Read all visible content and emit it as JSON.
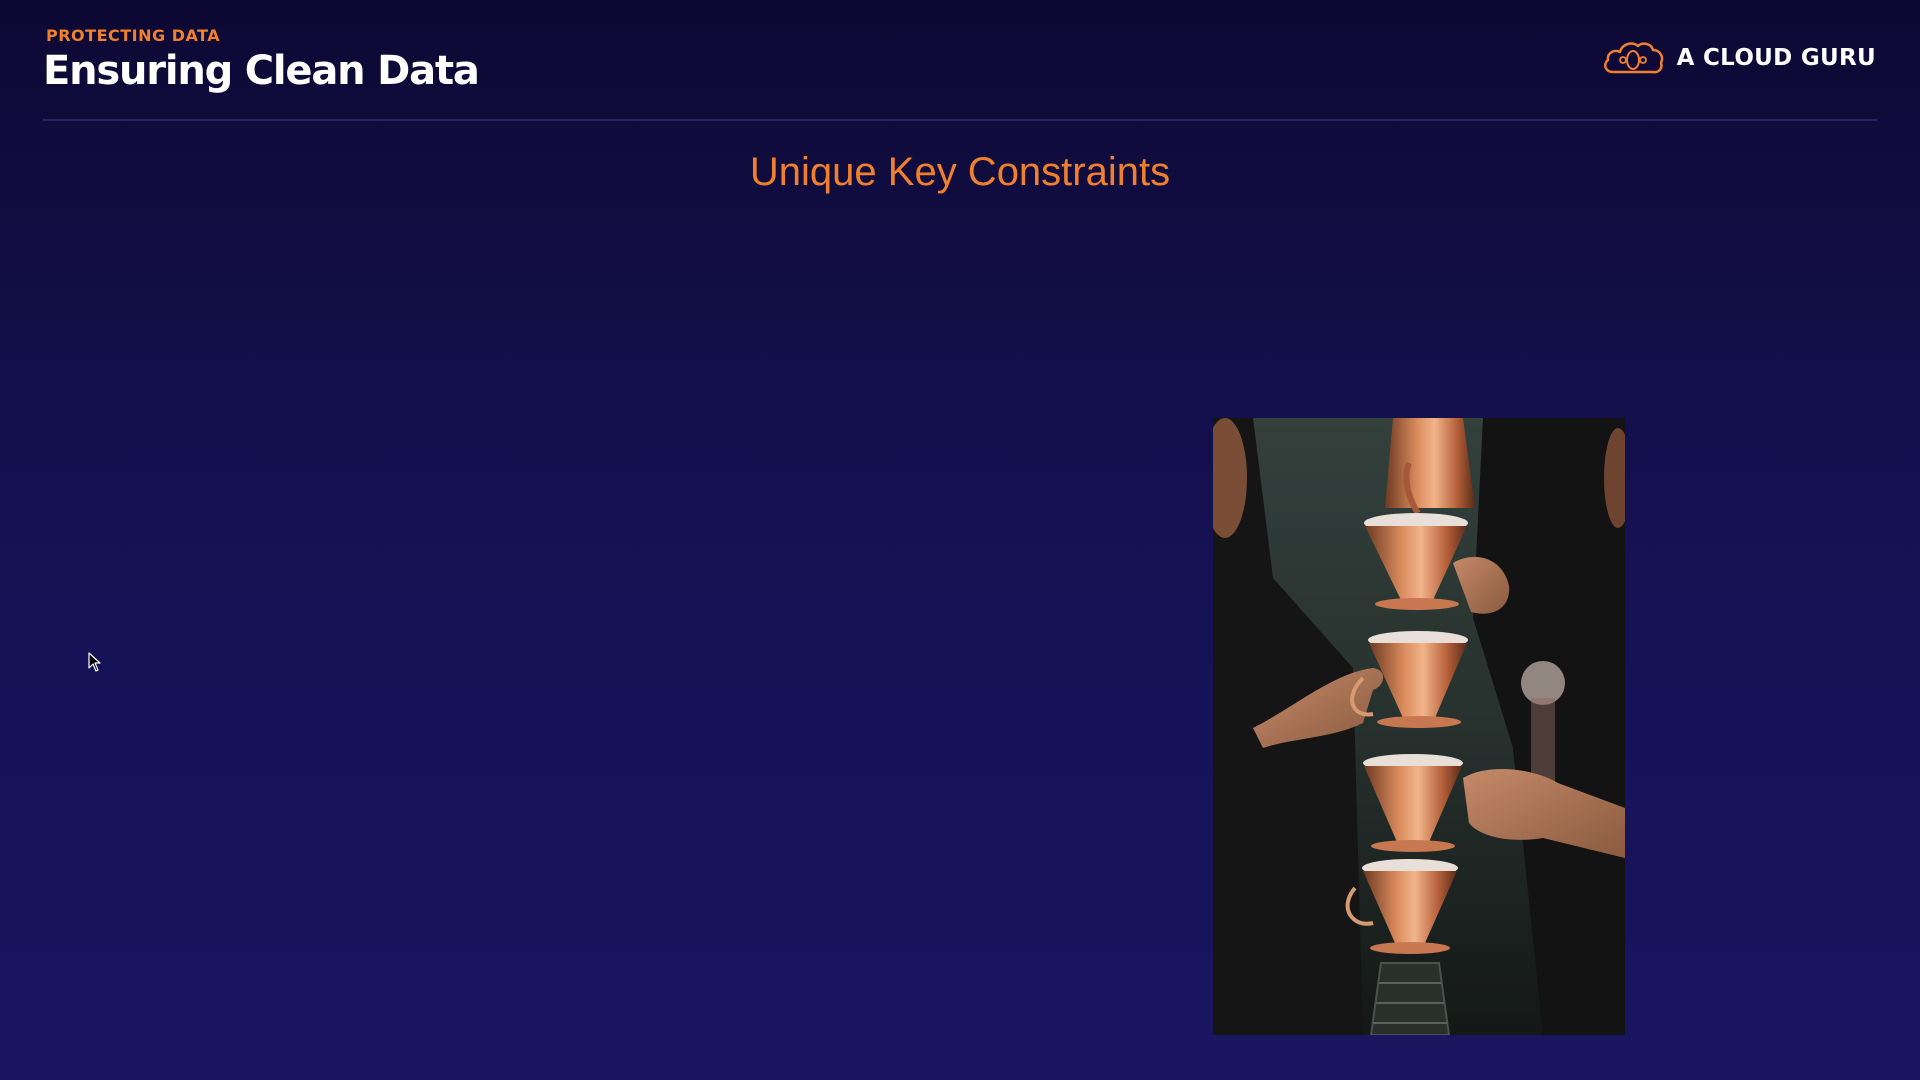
{
  "header": {
    "eyebrow": "PROTECTING DATA",
    "title": "Ensuring Clean Data"
  },
  "brand": {
    "name": "A CLOUD GURU",
    "logo_icon": "cloud-logo-icon",
    "accent_color": "#f07f2e"
  },
  "slide": {
    "heading": "Unique Key Constraints",
    "heading_color": "#f07f2e",
    "image": {
      "subject": "coffee-pour-over-photo"
    }
  },
  "colors": {
    "background_top": "#0d0833",
    "background_bottom": "#19155e",
    "accent": "#f07f2e"
  }
}
